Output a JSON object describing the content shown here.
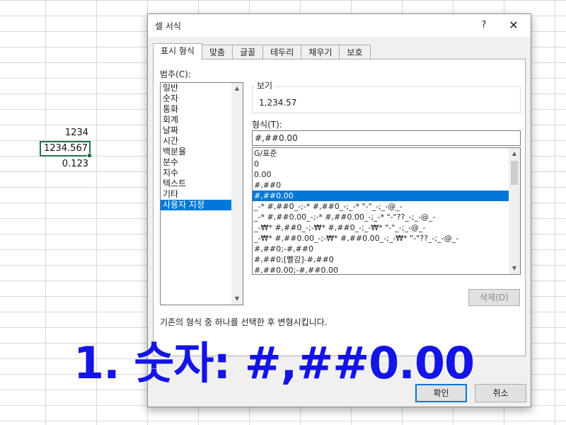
{
  "sheet": {
    "cells": [
      "1234",
      "1234.567",
      "0.123"
    ]
  },
  "dialog": {
    "title": "셀 서식",
    "help_label": "?",
    "close_label": "✕",
    "tabs": [
      "표시 형식",
      "맞춤",
      "글꼴",
      "테두리",
      "채우기",
      "보호"
    ],
    "category_label": "범주(C):",
    "categories": [
      "일반",
      "숫자",
      "통화",
      "회계",
      "날짜",
      "시간",
      "백분율",
      "분수",
      "지수",
      "텍스트",
      "기타",
      "사용자 지정"
    ],
    "selected_category": "사용자 지정",
    "sample_title": "보기",
    "sample_value": "1,234.57",
    "type_label": "형식(T):",
    "type_value": "#,##0.00",
    "formats": [
      "G/표준",
      "0",
      "0.00",
      "#,##0",
      "#,##0.00",
      "_-* #,##0_-;-* #,##0_-;_-* \"-\"_-;_-@_-",
      "_-* #,##0.00_-;-* #,##0.00_-;_-* \"-\"??_-;_-@_-",
      "_-₩* #,##0_-;-₩* #,##0_-;_-₩* \"-\"_-;_-@_-",
      "_-₩* #,##0.00_-;-₩* #,##0.00_-;_-₩* \"-\"??_-;_-@_-",
      "#,##0;-#,##0",
      "#,##0;[빨강]-#,##0",
      "#,##0.00;-#,##0.00"
    ],
    "selected_format": "#,##0.00",
    "delete_label": "삭제(D)",
    "description": "기존의 형식 중 하나를 선택한 후 변형시킵니다.",
    "ok_label": "확인",
    "cancel_label": "취소"
  },
  "caption": "1. 숫자: #,##0.00",
  "colors": {
    "selection": "#0078d7",
    "excel_green": "#217346",
    "caption_blue": "#1414e6"
  }
}
